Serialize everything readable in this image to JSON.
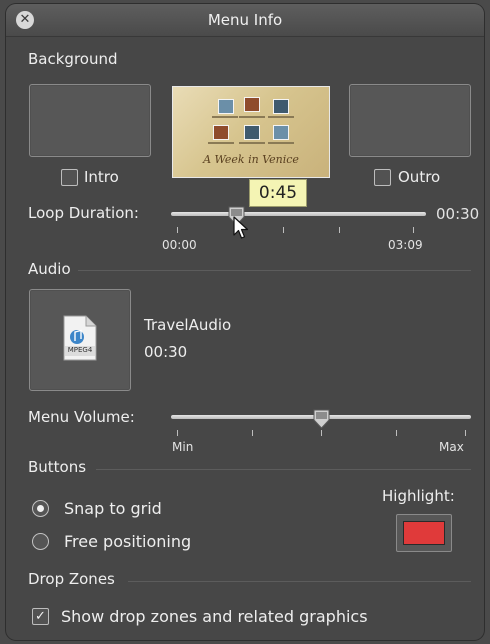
{
  "window": {
    "title": "Menu Info"
  },
  "background": {
    "section_label": "Background",
    "intro_label": "Intro",
    "intro_checked": false,
    "outro_label": "Outro",
    "outro_checked": false,
    "theme_thumbnail_caption": "A Week in Venice",
    "loop_duration": {
      "label": "Loop Duration:",
      "value_label": "00:30",
      "tooltip": "0:45",
      "min_label": "00:00",
      "max_label": "03:09",
      "position": 0.2
    }
  },
  "audio": {
    "section_label": "Audio",
    "file_badge": "MPEG4",
    "track_name": "TravelAudio",
    "track_duration": "00:30",
    "volume": {
      "label": "Menu Volume:",
      "min_label": "Min",
      "max_label": "Max",
      "level": 0.5
    }
  },
  "buttons": {
    "section_label": "Buttons",
    "options": [
      {
        "label": "Snap to grid",
        "selected": true
      },
      {
        "label": "Free positioning",
        "selected": false
      }
    ],
    "highlight_label": "Highlight:",
    "highlight_color": "#e03a3a"
  },
  "drop_zones": {
    "section_label": "Drop Zones",
    "show_label": "Show drop zones and related graphics",
    "show_checked": true
  }
}
